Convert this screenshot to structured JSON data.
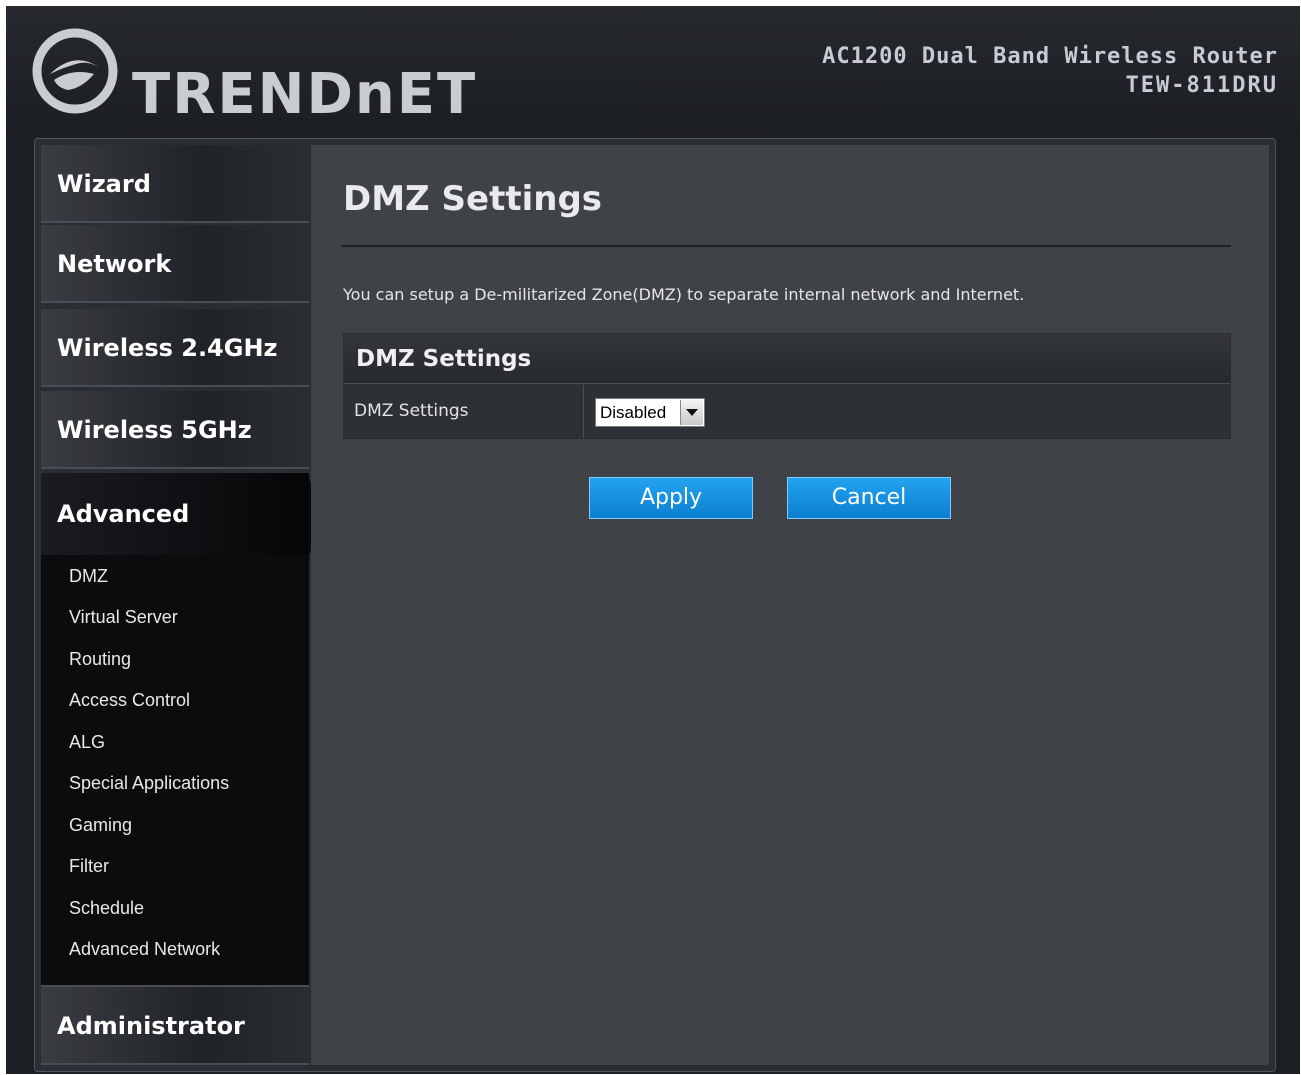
{
  "header": {
    "brand": "TRENDnET",
    "product_name": "AC1200 Dual Band Wireless Router",
    "model": "TEW-811DRU"
  },
  "sidebar": {
    "items": [
      {
        "label": "Wizard"
      },
      {
        "label": "Network"
      },
      {
        "label": "Wireless 2.4GHz"
      },
      {
        "label": "Wireless 5GHz"
      },
      {
        "label": "Advanced"
      },
      {
        "label": "Administrator"
      }
    ],
    "advanced_subitems": [
      "DMZ",
      "Virtual Server",
      "Routing",
      "Access Control",
      "ALG",
      "Special Applications",
      "Gaming",
      "Filter",
      "Schedule",
      "Advanced Network"
    ]
  },
  "main": {
    "title": "DMZ Settings",
    "description": "You can setup a De-militarized Zone(DMZ) to separate internal network and Internet.",
    "table": {
      "header": "DMZ Settings",
      "row_label": "DMZ Settings",
      "select_value": "Disabled"
    },
    "buttons": {
      "apply": "Apply",
      "cancel": "Cancel"
    }
  },
  "colors": {
    "accent_button": "#1192e0",
    "background": "#1c1f24",
    "content": "#3f4348"
  }
}
